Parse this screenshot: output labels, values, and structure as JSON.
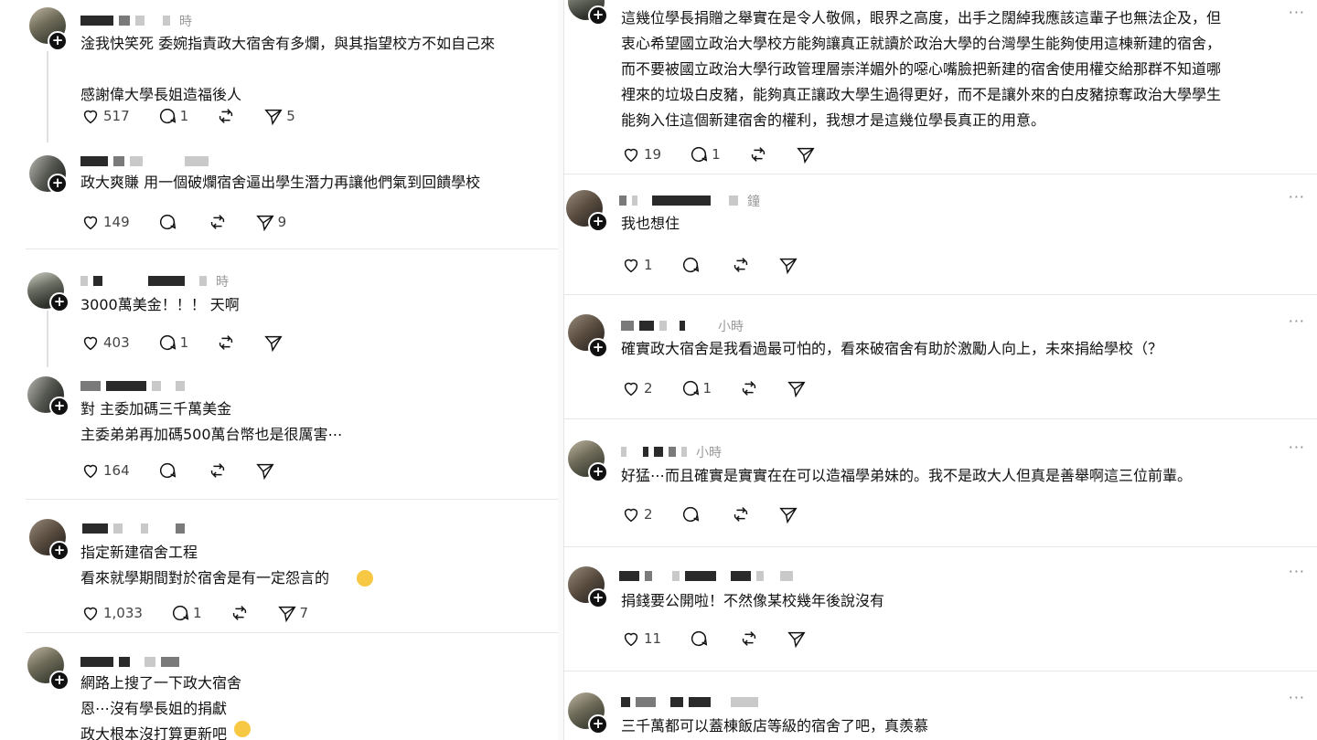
{
  "left": {
    "posts": [
      {
        "time": "時",
        "text": "淦我快笑死 委婉指責政大宿舍有多爛，與其指望校方不如自己來\n\n感謝偉大學長姐造福後人",
        "likes": "517",
        "replies": "1",
        "shares": "5"
      },
      {
        "time": "",
        "text": "政大爽賺 用一個破爛宿舍逼出學生潛力再讓他們氣到回饋學校",
        "likes": "149",
        "replies": "",
        "shares": "9"
      },
      {
        "time": "時",
        "text": "3000萬美金！！！ 天啊",
        "likes": "403",
        "replies": "1",
        "shares": ""
      },
      {
        "time": "",
        "text": "對 主委加碼三千萬美金\n主委弟弟再加碼500萬台幣也是很厲害⋯",
        "likes": "164",
        "replies": "",
        "shares": ""
      },
      {
        "time": "",
        "text": "指定新建宿舍工程\n看來就學期間對於宿舍是有一定怨言的",
        "likes": "1,033",
        "replies": "1",
        "shares": "7"
      },
      {
        "time": "",
        "text": "網路上搜了一下政大宿舍\n恩⋯沒有學長姐的捐獻\n政大根本沒打算更新吧",
        "likes": "",
        "replies": "",
        "shares": ""
      }
    ]
  },
  "right": {
    "posts": [
      {
        "time": "",
        "text": "這幾位學長捐贈之舉實在是令人敬佩，眼界之高度，出手之闊綽我應該這輩子也無法企及，但\n衷心希望國立政治大學校方能夠讓真正就讀於政治大學的台灣學生能夠使用這棟新建的宿舍，\n而不要被國立政治大學行政管理層崇洋媚外的噁心嘴臉把新建的宿舍使用權交給那群不知道哪\n裡來的垃圾白皮豬，能夠真正讓政大學生過得更好，而不是讓外來的白皮豬掠奪政治大學學生\n能夠入住這個新建宿舍的權利，我想才是這幾位學長真正的用意。",
        "likes": "19",
        "replies": "1",
        "shares": ""
      },
      {
        "time": "鐘",
        "text": "我也想住",
        "likes": "1",
        "replies": "",
        "shares": ""
      },
      {
        "time": "小時",
        "text": "確實政大宿舍是我看過最可怕的，看來破宿舍有助於激勵人向上，未來捐給學校（？",
        "likes": "2",
        "replies": "1",
        "shares": ""
      },
      {
        "time": "小時",
        "text": "好猛⋯而且確實是實實在在可以造福學弟妹的。我不是政大人但真是善舉啊這三位前輩。",
        "likes": "2",
        "replies": "",
        "shares": ""
      },
      {
        "time": "",
        "text": "捐錢要公開啦！不然像某校幾年後說沒有",
        "likes": "11",
        "replies": "",
        "shares": ""
      },
      {
        "time": "",
        "text": "三千萬都可以蓋棟飯店等級的宿舍了吧，真羨慕",
        "likes": "",
        "replies": "",
        "shares": ""
      }
    ],
    "more_label": "···"
  },
  "icons": {
    "like": "heart-icon",
    "reply": "comment-icon",
    "repost": "repost-icon",
    "share": "send-icon",
    "follow": "plus-icon"
  }
}
